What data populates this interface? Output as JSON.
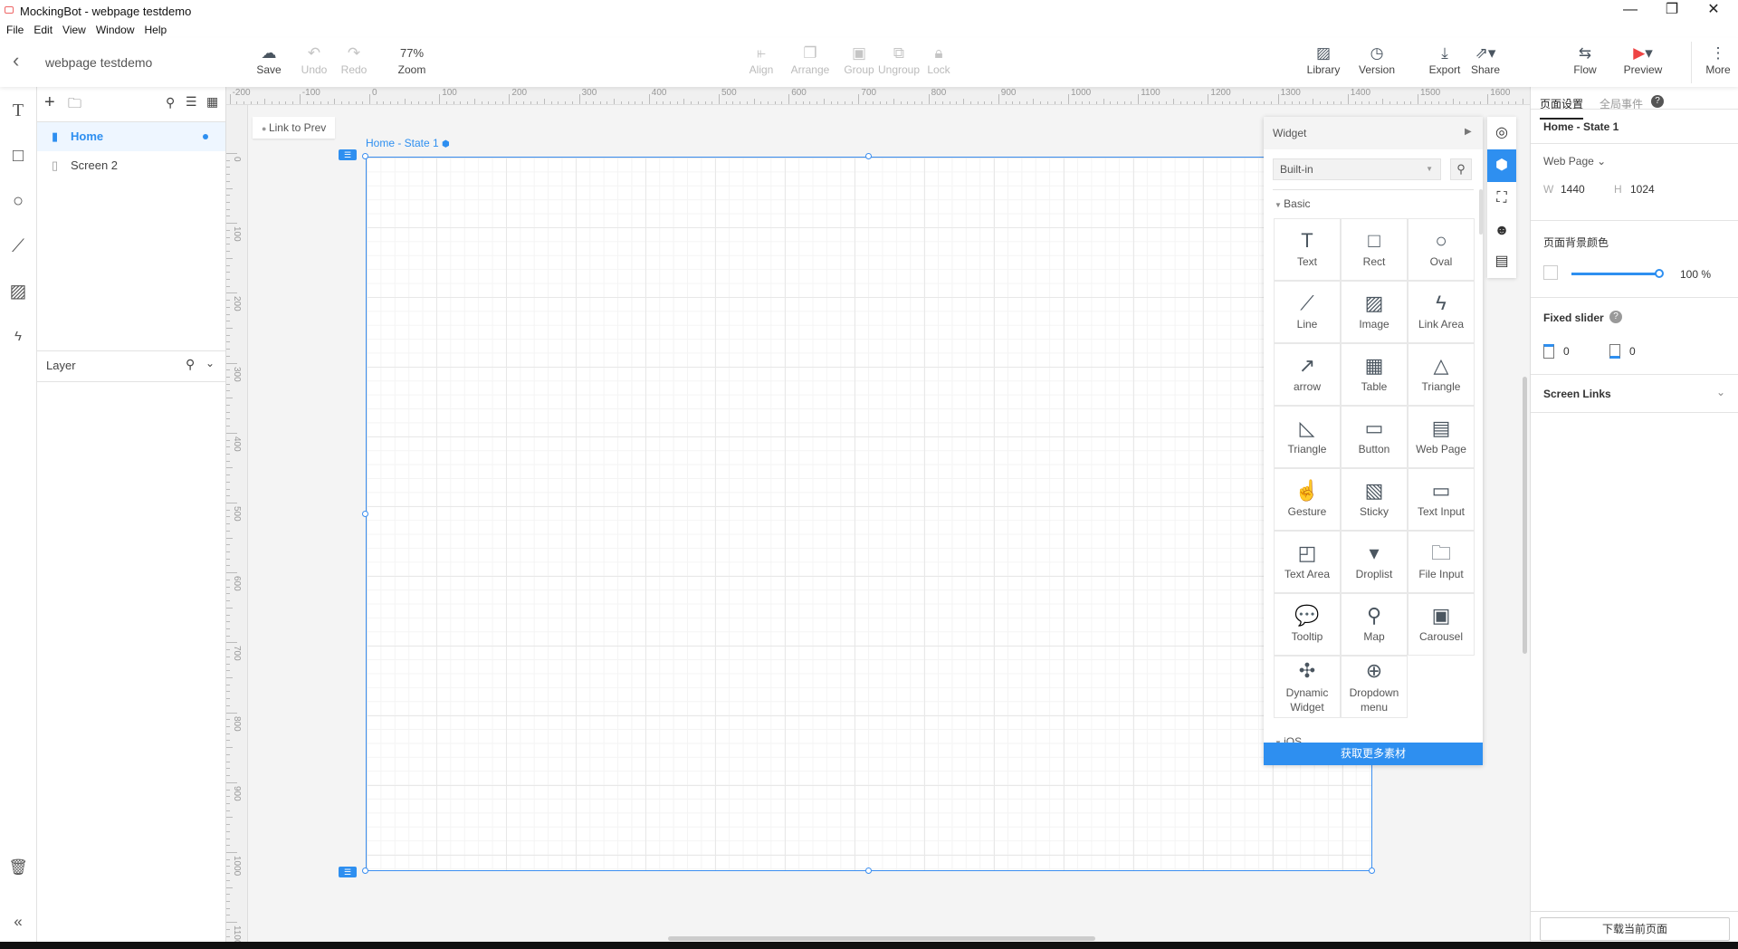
{
  "window": {
    "title": "MockingBot - webpage testdemo",
    "minimize": "—",
    "maximize": "❐",
    "close": "✕"
  },
  "menu": [
    "File",
    "Edit",
    "View",
    "Window",
    "Help"
  ],
  "toolbar": {
    "back": "‹",
    "project": "webpage testdemo",
    "save": "Save",
    "undo": "Undo",
    "redo": "Redo",
    "zoom_value": "77%",
    "zoom": "Zoom",
    "align": "Align",
    "arrange": "Arrange",
    "group": "Group",
    "ungroup": "Ungroup",
    "lock": "Lock",
    "library": "Library",
    "version": "Version",
    "export": "Export",
    "share": "Share",
    "flow": "Flow",
    "preview": "Preview",
    "more": "More"
  },
  "pages": {
    "items": [
      {
        "label": "Home",
        "active": true
      },
      {
        "label": "Screen 2",
        "active": false
      }
    ],
    "layer": "Layer"
  },
  "canvas": {
    "link_prev": "Link to Prev",
    "state_label": "Home - State 1",
    "accent": "#2e8ff0"
  },
  "rulers": {
    "top": [
      "-200",
      "-100",
      "0",
      "100",
      "200",
      "300",
      "400",
      "500",
      "600",
      "700",
      "800",
      "900",
      "1000",
      "1100",
      "1200",
      "1300",
      "1400",
      "1500",
      "1600"
    ],
    "left": [
      "0",
      "100",
      "200",
      "300",
      "400",
      "500",
      "600",
      "700",
      "800",
      "900",
      "1000",
      "1100"
    ]
  },
  "widget": {
    "title": "Widget",
    "library": "Built-in",
    "section": "Basic",
    "next_section": "iOS",
    "more_button": "获取更多素材",
    "items": [
      {
        "label": "Text",
        "icon": "T"
      },
      {
        "label": "Rect",
        "icon": "□"
      },
      {
        "label": "Oval",
        "icon": "○"
      },
      {
        "label": "Line",
        "icon": "⟋"
      },
      {
        "label": "Image",
        "icon": "▨"
      },
      {
        "label": "Link Area",
        "icon": "ϟ"
      },
      {
        "label": "arrow",
        "icon": "↗"
      },
      {
        "label": "Table",
        "icon": "▦"
      },
      {
        "label": "Triangle",
        "icon": "△"
      },
      {
        "label": "Triangle",
        "icon": "◺"
      },
      {
        "label": "Button",
        "icon": "▭"
      },
      {
        "label": "Web Page",
        "icon": "▤"
      },
      {
        "label": "Gesture",
        "icon": "☝"
      },
      {
        "label": "Sticky",
        "icon": "▧"
      },
      {
        "label": "Text Input",
        "icon": "▭"
      },
      {
        "label": "Text Area",
        "icon": "◰"
      },
      {
        "label": "Droplist",
        "icon": "▾"
      },
      {
        "label": "File Input",
        "icon": "🗀"
      },
      {
        "label": "Tooltip",
        "icon": "💬"
      },
      {
        "label": "Map",
        "icon": "⚲"
      },
      {
        "label": "Carousel",
        "icon": "▣"
      },
      {
        "label": "Dynamic Widget",
        "icon": "✣"
      },
      {
        "label": "Dropdown menu",
        "icon": "⊕"
      }
    ]
  },
  "right": {
    "tab1": "页面设置",
    "tab2": "全局事件",
    "state": "Home - State 1",
    "device": "Web Page",
    "w_label": "W",
    "w": "1440",
    "h_label": "H",
    "h": "1024",
    "bg_title": "页面背景颜色",
    "opacity": "100 %",
    "opacity_value": 100,
    "fixed": "Fixed slider",
    "fixed_top": "0",
    "fixed_bottom": "0",
    "links": "Screen Links",
    "download": "下载当前页面"
  }
}
